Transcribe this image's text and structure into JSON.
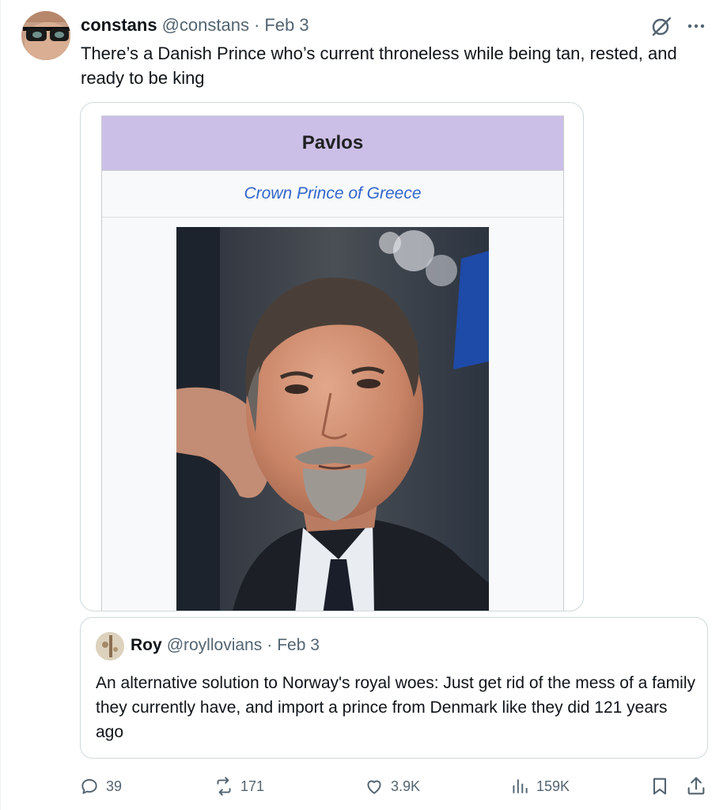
{
  "tweet": {
    "author": {
      "display_name": "constans",
      "handle": "@constans",
      "avatar_icon": "avatar-sunglasses"
    },
    "separator": "·",
    "date": "Feb 3",
    "text": "There’s a Danish Prince who’s current throneless while being tan, rested, and ready to be king",
    "header_icons": [
      "grok-icon",
      "more-icon"
    ]
  },
  "media": {
    "infobox_title": "Pavlos",
    "infobox_subtitle": "Crown Prince of Greece",
    "photo_icon": "portrait-photo"
  },
  "quote": {
    "display_name": "Roy",
    "handle": "@royllovians",
    "separator": "·",
    "date": "Feb 3",
    "text": "An alternative solution to Norway's royal woes: Just get rid of the mess of a family they currently have, and import a prince from Denmark like they did 121 years ago"
  },
  "actions": {
    "replies": "39",
    "reposts": "171",
    "likes": "3.9K",
    "views": "159K"
  },
  "colors": {
    "secondary_text": "#536471",
    "infobox_header": "#ccbfe7",
    "link_blue": "#3366cc",
    "border": "#cfd9de"
  }
}
